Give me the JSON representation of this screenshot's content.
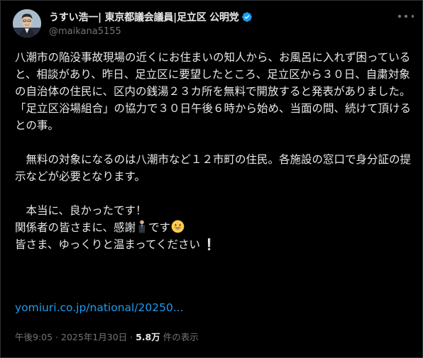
{
  "author": {
    "display_name": "うすい浩一| 東京都議会議員|足立区 公明党",
    "handle": "@maikana5155",
    "verified_icon": "verified-badge-icon",
    "colors": {
      "verified": "#1d9bf0"
    }
  },
  "tweet": {
    "paragraph_1": "八潮市の陥没事故現場の近くにお住まいの知人から、お風呂に入れず困っていると、相談があり、昨日、足立区に要望したところ、足立区から３０日、自粛対象の自治体の住民に、区内の銭湯２３カ所を無料で開放すると発表がありました。",
    "paragraph_2": "「足立区浴場組合」の協力で３０日午後６時から始め、当面の間、続けて頂けるとの事。",
    "paragraph_3": "　無料の対象になるのは八潮市など１２市町の住民。各施設の窓口で身分証の提示などが必要となります。",
    "paragraph_4": "　本当に、良かったです！",
    "line_5_prefix": "関係者の皆さまに、感謝",
    "line_5_suffix": "です",
    "line_6": "皆さま、ゆっくりと温まってください",
    "emojis": [
      "person-icon",
      "smiley-face-icon",
      "exclamation-icon"
    ],
    "link": "yomiuri.co.jp/national/20250..."
  },
  "meta": {
    "time": "午後9:05",
    "sep1": " · ",
    "date": "2025年1月30日",
    "sep2": " · ",
    "views_count": "5.8万",
    "views_label": " 件の表示"
  },
  "colors": {
    "background": "#000000",
    "text": "#e7e9ea",
    "muted": "#71767b",
    "link": "#1d9bf0",
    "border": "#2f3336"
  }
}
